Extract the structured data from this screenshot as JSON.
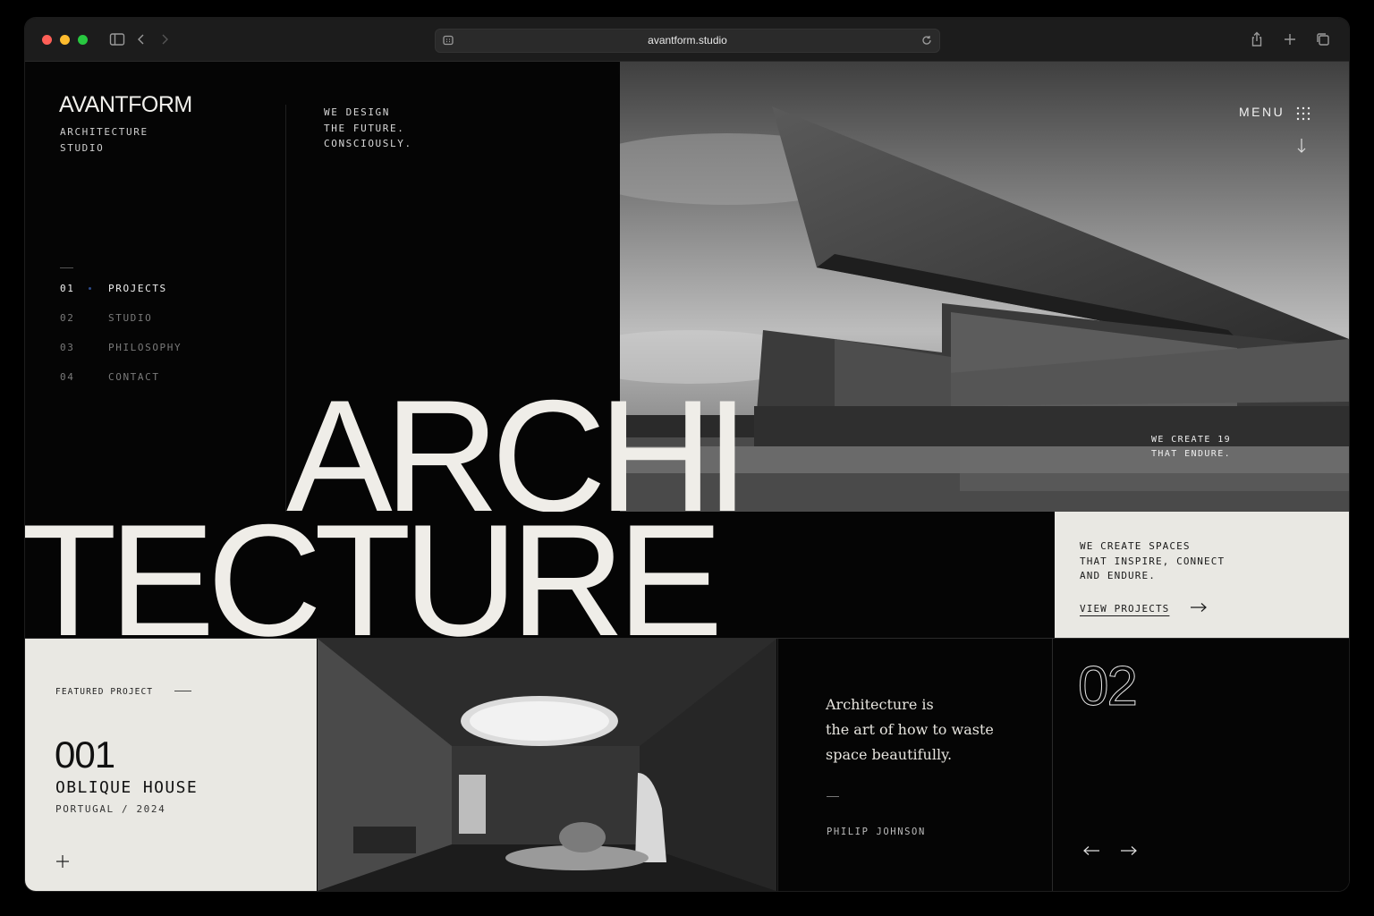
{
  "browser": {
    "url": "avantform.studio"
  },
  "brand": {
    "name": "AVANTFORM",
    "subtitle_line1": "ARCHITECTURE",
    "subtitle_line2": "STUDIO"
  },
  "tagline": {
    "line1": "WE DESIGN",
    "line2": "THE FUTURE.",
    "line3": "CONSCIOUSLY."
  },
  "nav": {
    "items": [
      {
        "num": "01",
        "label": "PROJECTS",
        "active": true
      },
      {
        "num": "02",
        "label": "STUDIO",
        "active": false
      },
      {
        "num": "03",
        "label": "PHILOSOPHY",
        "active": false
      },
      {
        "num": "04",
        "label": "CONTACT",
        "active": false
      }
    ]
  },
  "header": {
    "menu_label": "MENU"
  },
  "hero": {
    "word_top": "ARCHI",
    "word_bottom": "TECTURE",
    "caption_line1": "WE CREATE 19",
    "caption_line2": "THAT ENDURE."
  },
  "info_card": {
    "line1": "WE CREATE SPACES",
    "line2": "THAT INSPIRE, CONNECT",
    "line3": "AND ENDURE.",
    "link_label": "VIEW PROJECTS"
  },
  "featured": {
    "label": "FEATURED PROJECT",
    "number": "001",
    "title": "OBLIQUE HOUSE",
    "subtitle": "PORTUGAL / 2024"
  },
  "quote": {
    "line1": "Architecture is",
    "line2": "the art of how to waste",
    "line3": "space beautifully.",
    "author": "PHILIP JOHNSON"
  },
  "slider": {
    "counter": "02"
  },
  "colors": {
    "background": "#050505",
    "cream": "#e9e8e3",
    "text_light": "#efede8",
    "active_dot": "#2d4a8a"
  }
}
